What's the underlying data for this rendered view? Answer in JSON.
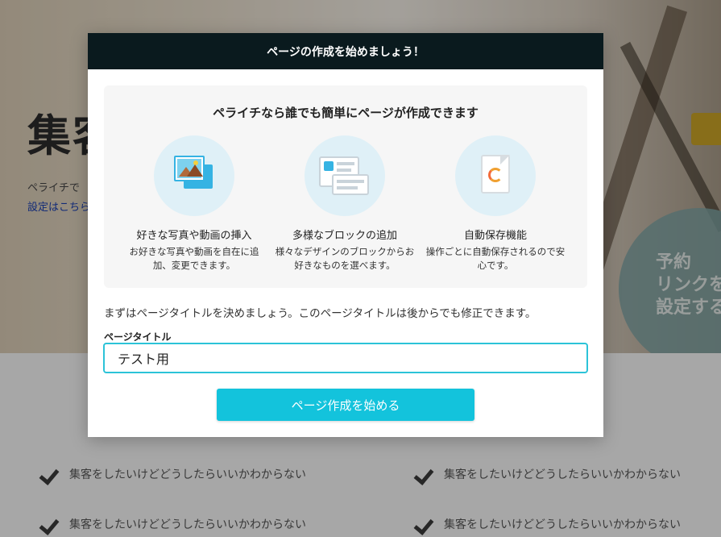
{
  "background": {
    "hero_title": "集客",
    "hero_desc": "ペライチで",
    "hero_link": "設定はこちら",
    "circle_text": [
      "予約",
      "リンクを",
      "設定する"
    ],
    "check_items": [
      "集客をしたいけどどうしたらいいかわからない",
      "集客をしたいけどどうしたらいいかわからない",
      "集客をしたいけどどうしたらいいかわからない",
      "集客をしたいけどどうしたらいいかわからない"
    ]
  },
  "modal": {
    "header_title": "ページの作成を始めましょう！",
    "feature_heading": "ペライチなら誰でも簡単にページが作成できます",
    "features": [
      {
        "name": "好きな写真や動画の挿入",
        "desc": "お好きな写真や動画を自在に追加、変更できます。",
        "icon": "photo-icon"
      },
      {
        "name": "多様なブロックの追加",
        "desc": "様々なデザインのブロックからお好きなものを選べます。",
        "icon": "blocks-icon"
      },
      {
        "name": "自動保存機能",
        "desc": "操作ごとに自動保存されるので安心です。",
        "icon": "autosave-file-icon"
      }
    ],
    "intro_text": "まずはページタイトルを決めましょう。このページタイトルは後からでも修正できます。",
    "field_label": "ページタイトル",
    "title_value": "テスト用",
    "start_button": "ページ作成を始める"
  },
  "colors": {
    "header_bg": "#0a1a1e",
    "accent": "#13c3dc",
    "input_border": "#2cc3d8"
  }
}
